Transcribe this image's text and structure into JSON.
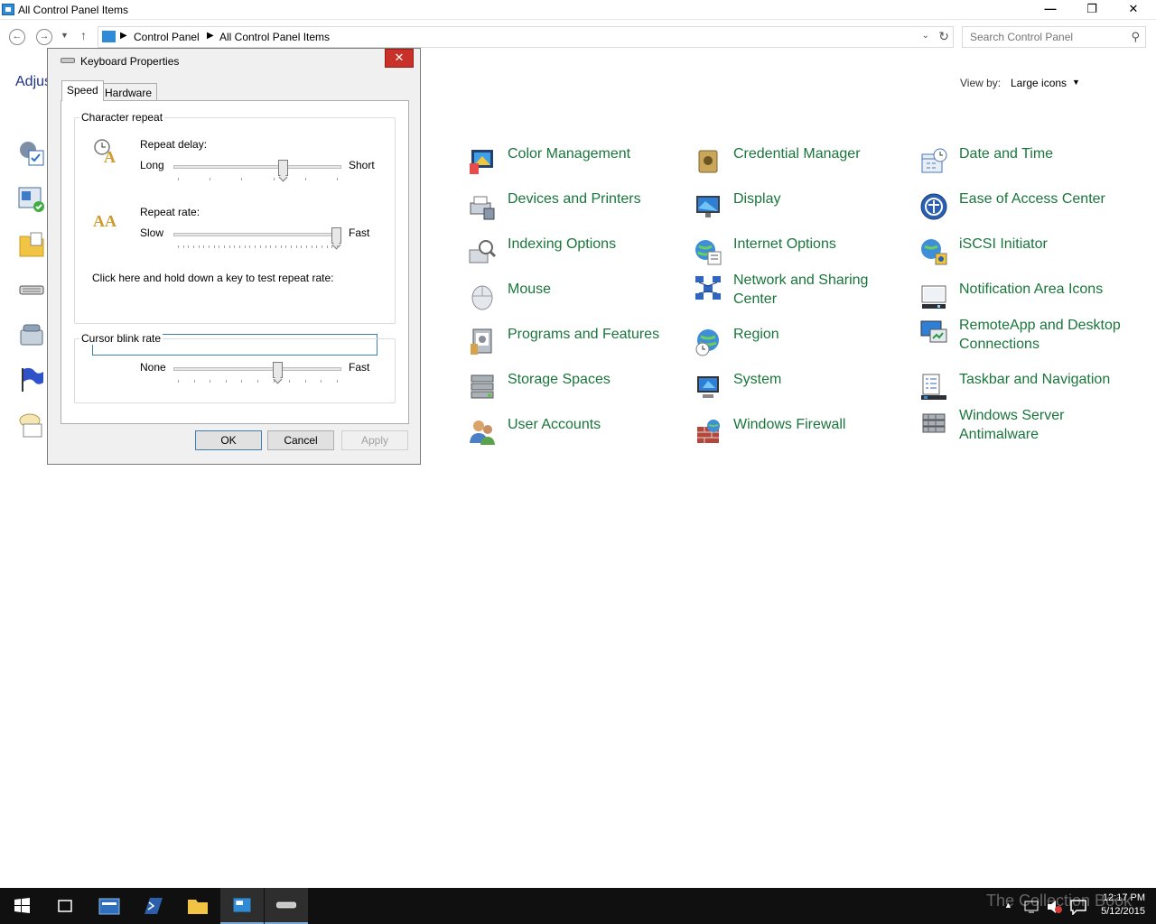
{
  "window": {
    "title": "All Control Panel Items",
    "minimize": "—",
    "maximize": "❐",
    "close": "✕"
  },
  "nav": {
    "back": "←",
    "forward": "→",
    "up": "↑",
    "breadcrumb": [
      "Control Panel",
      "All Control Panel Items"
    ],
    "separator": "▶",
    "refresh": "↻",
    "search_placeholder": "Search Control Panel"
  },
  "content": {
    "adjust_label": "Adjus",
    "view_by_label": "View by:",
    "view_by_value": "Large icons"
  },
  "items": [
    {
      "label": "Color Management",
      "icon": "color-management-icon"
    },
    {
      "label": "Credential Manager",
      "icon": "credential-manager-icon"
    },
    {
      "label": "Date and Time",
      "icon": "date-time-icon"
    },
    {
      "label": "Devices and Printers",
      "icon": "devices-printers-icon"
    },
    {
      "label": "Display",
      "icon": "display-icon"
    },
    {
      "label": "Ease of Access Center",
      "icon": "ease-of-access-icon"
    },
    {
      "label": "Indexing Options",
      "icon": "indexing-options-icon"
    },
    {
      "label": "Internet Options",
      "icon": "internet-options-icon"
    },
    {
      "label": "iSCSI Initiator",
      "icon": "iscsi-initiator-icon"
    },
    {
      "label": "Mouse",
      "icon": "mouse-icon"
    },
    {
      "label": "Network and Sharing Center",
      "icon": "network-sharing-icon"
    },
    {
      "label": "Notification Area Icons",
      "icon": "notification-area-icon"
    },
    {
      "label": "Programs and Features",
      "icon": "programs-features-icon"
    },
    {
      "label": "Region",
      "icon": "region-icon"
    },
    {
      "label": "RemoteApp and Desktop Connections",
      "icon": "remoteapp-icon"
    },
    {
      "label": "Storage Spaces",
      "icon": "storage-spaces-icon"
    },
    {
      "label": "System",
      "icon": "system-icon"
    },
    {
      "label": "Taskbar and Navigation",
      "icon": "taskbar-navigation-icon"
    },
    {
      "label": "User Accounts",
      "icon": "user-accounts-icon"
    },
    {
      "label": "Windows Firewall",
      "icon": "windows-firewall-icon"
    },
    {
      "label": "Windows Server Antimalware",
      "icon": "antimalware-icon"
    }
  ],
  "dialog": {
    "title": "Keyboard Properties",
    "close": "✕",
    "tabs": {
      "speed": "Speed",
      "hardware": "Hardware"
    },
    "character_repeat": {
      "group_label": "Character repeat",
      "repeat_delay_label": "Repeat delay:",
      "delay_min_label": "Long",
      "delay_max_label": "Short",
      "delay_value": 0.66,
      "repeat_rate_label": "Repeat rate:",
      "rate_min_label": "Slow",
      "rate_max_label": "Fast",
      "rate_value": 1.0,
      "test_label": "Click here and hold down a key to test repeat rate:",
      "test_value": ""
    },
    "cursor_blink": {
      "group_label": "Cursor blink rate",
      "min_label": "None",
      "max_label": "Fast",
      "value": 0.63
    },
    "buttons": {
      "ok": "OK",
      "cancel": "Cancel",
      "apply": "Apply"
    }
  },
  "taskbar": {
    "time": "12:17 PM",
    "date": "5/12/2015",
    "watermark": "The Collection Book",
    "tray_up": "▲"
  },
  "colors": {
    "link_green": "#19753b",
    "close_red": "#c7312a",
    "taskbar": "#101010"
  }
}
